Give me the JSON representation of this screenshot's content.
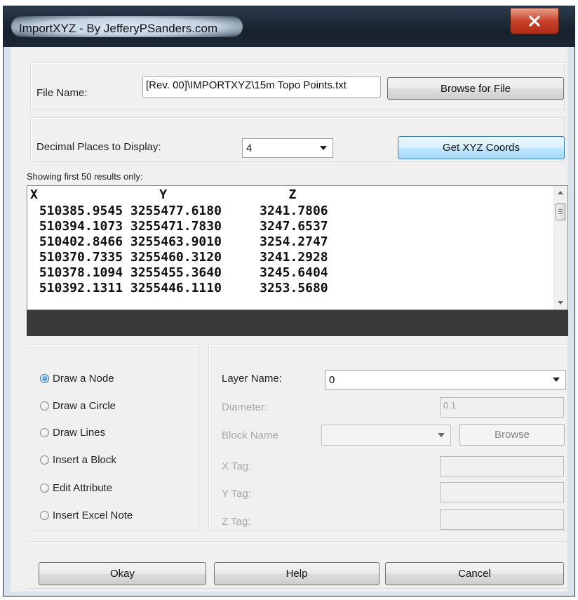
{
  "window": {
    "title": "ImportXYZ - By JefferyPSanders.com",
    "close_glyph": "X"
  },
  "file": {
    "label": "File Name:",
    "value": "[Rev. 00]\\IMPORTXYZ\\15m Topo Points.txt",
    "browse_label": "Browse for File"
  },
  "decimal": {
    "label": "Decimal Places to Display:",
    "value": "4",
    "get_coords_label": "Get XYZ Coords"
  },
  "results": {
    "note": "Showing first 50 results only:",
    "header": "X                Y                Z",
    "rows": [
      " 510385.9545 3255477.6180     3241.7806",
      " 510394.1073 3255471.7830     3247.6537",
      " 510402.8466 3255463.9010     3254.2747",
      " 510370.7335 3255460.3120     3241.2928",
      " 510378.1094 3255455.3640     3245.6404",
      " 510392.1311 3255446.1110     3253.5680"
    ]
  },
  "draw_options": [
    {
      "label": "Draw a Node",
      "selected": true
    },
    {
      "label": "Draw a Circle",
      "selected": false
    },
    {
      "label": "Draw Lines",
      "selected": false
    },
    {
      "label": "Insert a Block",
      "selected": false
    },
    {
      "label": "Edit Attribute",
      "selected": false
    },
    {
      "label": "Insert Excel Note",
      "selected": false
    }
  ],
  "settings": {
    "layer_label": "Layer Name:",
    "layer_value": "0",
    "diameter_label": "Diameter:",
    "diameter_value": "0.1",
    "block_label": "Block Name",
    "block_value": "",
    "browse_label": "Browse",
    "xtag_label": "X Tag:",
    "ytag_label": "Y Tag:",
    "ztag_label": "Z Tag:"
  },
  "buttons": {
    "okay": "Okay",
    "help": "Help",
    "cancel": "Cancel"
  },
  "colors": {
    "titlebar": "#1b2633",
    "close": "#c7422b",
    "accent_button": "#bee6fd",
    "selected_radio": "#1c64b0"
  }
}
